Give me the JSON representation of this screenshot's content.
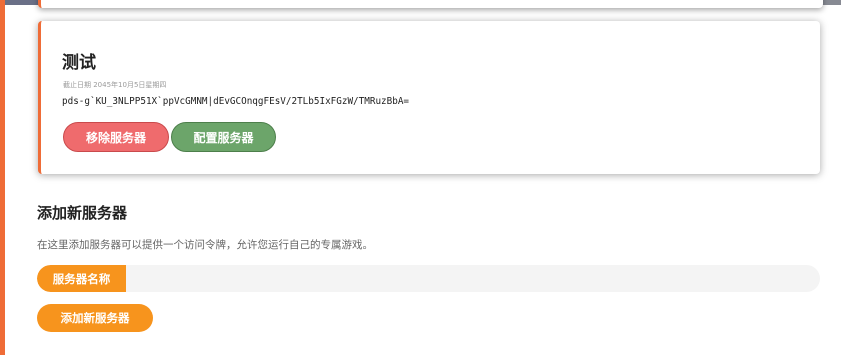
{
  "servers": [
    {
      "name": "测试",
      "expiry": "截止日期 2045年10月5日星期四",
      "token": "pds-g`KU_3NLPP51X`ppVcGMNM|dEvGCOnqgFEsV/2TLb5IxFGzW/TMRuzBbA=",
      "remove_label": "移除服务器",
      "configure_label": "配置服务器"
    }
  ],
  "add_server": {
    "title": "添加新服务器",
    "description": "在这里添加服务器可以提供一个访问令牌，允许您运行自己的专属游戏。",
    "name_label": "服务器名称",
    "name_value": "",
    "name_placeholder": "",
    "submit_label": "添加新服务器"
  },
  "colors": {
    "accent": "#ef6c37",
    "remove_button": "#ef6b6d",
    "configure_button": "#6ca56a",
    "add_button": "#f7941d"
  }
}
